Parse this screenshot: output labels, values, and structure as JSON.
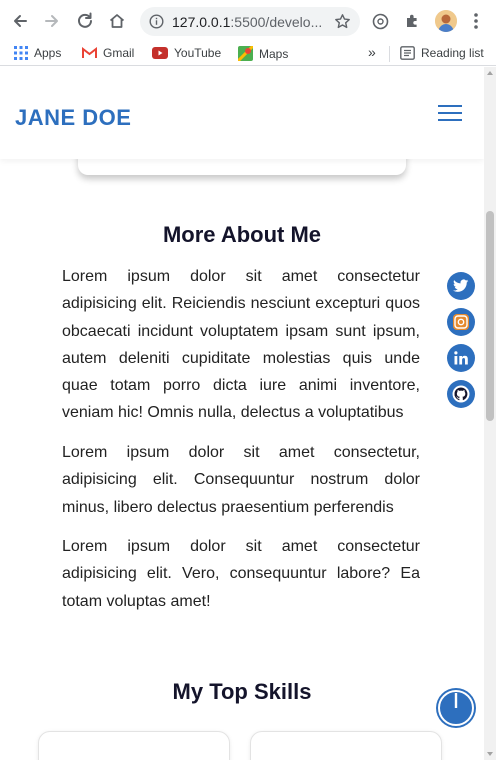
{
  "browser": {
    "url_host": "127.0.0.1",
    "url_rest": ":5500/develo...",
    "bookmarks": [
      {
        "label": "Apps",
        "icon": "apps-grid-icon"
      },
      {
        "label": "Gmail",
        "icon": "gmail-icon"
      },
      {
        "label": "YouTube",
        "icon": "youtube-icon"
      },
      {
        "label": "Maps",
        "icon": "maps-icon"
      }
    ],
    "overflow_label": "»",
    "reading_list": "Reading list"
  },
  "header": {
    "logo": "JANE DOE"
  },
  "about": {
    "title": "More About Me",
    "paragraphs": [
      "Lorem ipsum dolor sit amet consectetur adipisicing elit. Reiciendis nesciunt excepturi quos obcaecati incidunt voluptatem ipsam sunt ipsum, autem deleniti cupiditate molestias quis unde quae totam porro dicta iure animi inventore, veniam hic! Omnis nulla, delectus a voluptatibus",
      "Lorem ipsum dolor sit amet consectetur, adipisicing elit. Consequuntur nostrum dolor minus, libero delectus praesentium perferendis",
      "Lorem ipsum dolor sit amet consectetur adipisicing elit. Vero, consequuntur labore? Ea totam voluptas amet!"
    ]
  },
  "skills": {
    "title": "My Top Skills"
  },
  "social": [
    {
      "name": "twitter",
      "icon": "twitter-icon"
    },
    {
      "name": "instagram",
      "icon": "instagram-icon"
    },
    {
      "name": "linkedin",
      "icon": "linkedin-icon"
    },
    {
      "name": "github",
      "icon": "github-icon"
    }
  ],
  "colors": {
    "accent": "#2d6fbe",
    "heading": "#14142b"
  }
}
